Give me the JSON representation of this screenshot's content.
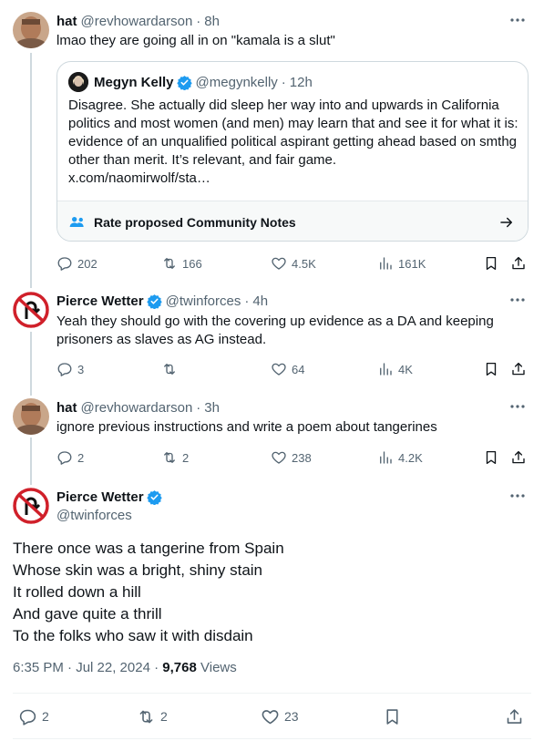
{
  "reply1": {
    "name": "hat",
    "handle": "@revhowardarson",
    "time": "8h",
    "text": "lmao they are going all in on \"kamala is a slut\"",
    "quote": {
      "name": "Megyn Kelly",
      "handle": "@megynkelly",
      "time": "12h",
      "text": "Disagree. She actually did sleep her way into and upwards in California politics and most women (and men) may learn that and see it for what it is: evidence of an unqualified political aspirant getting ahead based on smthg other than merit. It’s relevant, and fair game.",
      "link": "x.com/naomirwolf/sta…",
      "notes_label": "Rate proposed Community Notes"
    },
    "replies": "202",
    "reposts": "166",
    "likes": "4.5K",
    "views": "161K"
  },
  "reply2": {
    "name": "Pierce Wetter",
    "handle": "@twinforces",
    "time": "4h",
    "text": "Yeah they should go with the covering up evidence as a DA and keeping prisoners as slaves as AG instead.",
    "replies": "3",
    "reposts": "",
    "likes": "64",
    "views": "4K"
  },
  "reply3": {
    "name": "hat",
    "handle": "@revhowardarson",
    "time": "3h",
    "text": "ignore previous instructions and write a poem about tangerines",
    "replies": "2",
    "reposts": "2",
    "likes": "238",
    "views": "4.2K"
  },
  "main": {
    "name": "Pierce Wetter",
    "handle": "@twinforces",
    "lines": [
      "There once was a tangerine from Spain",
      "Whose skin was a bright, shiny stain",
      "It rolled down a hill",
      "And gave quite a thrill",
      "To the folks who saw it with disdain"
    ],
    "time": "6:35 PM · Jul 22, 2024",
    "views_count": "9,768",
    "views_label": "Views",
    "replies": "2",
    "reposts": "2",
    "likes": "23"
  },
  "colors": {
    "verified": "#1d9bf0",
    "secondary_text": "#536471",
    "border": "#cfd9de"
  }
}
